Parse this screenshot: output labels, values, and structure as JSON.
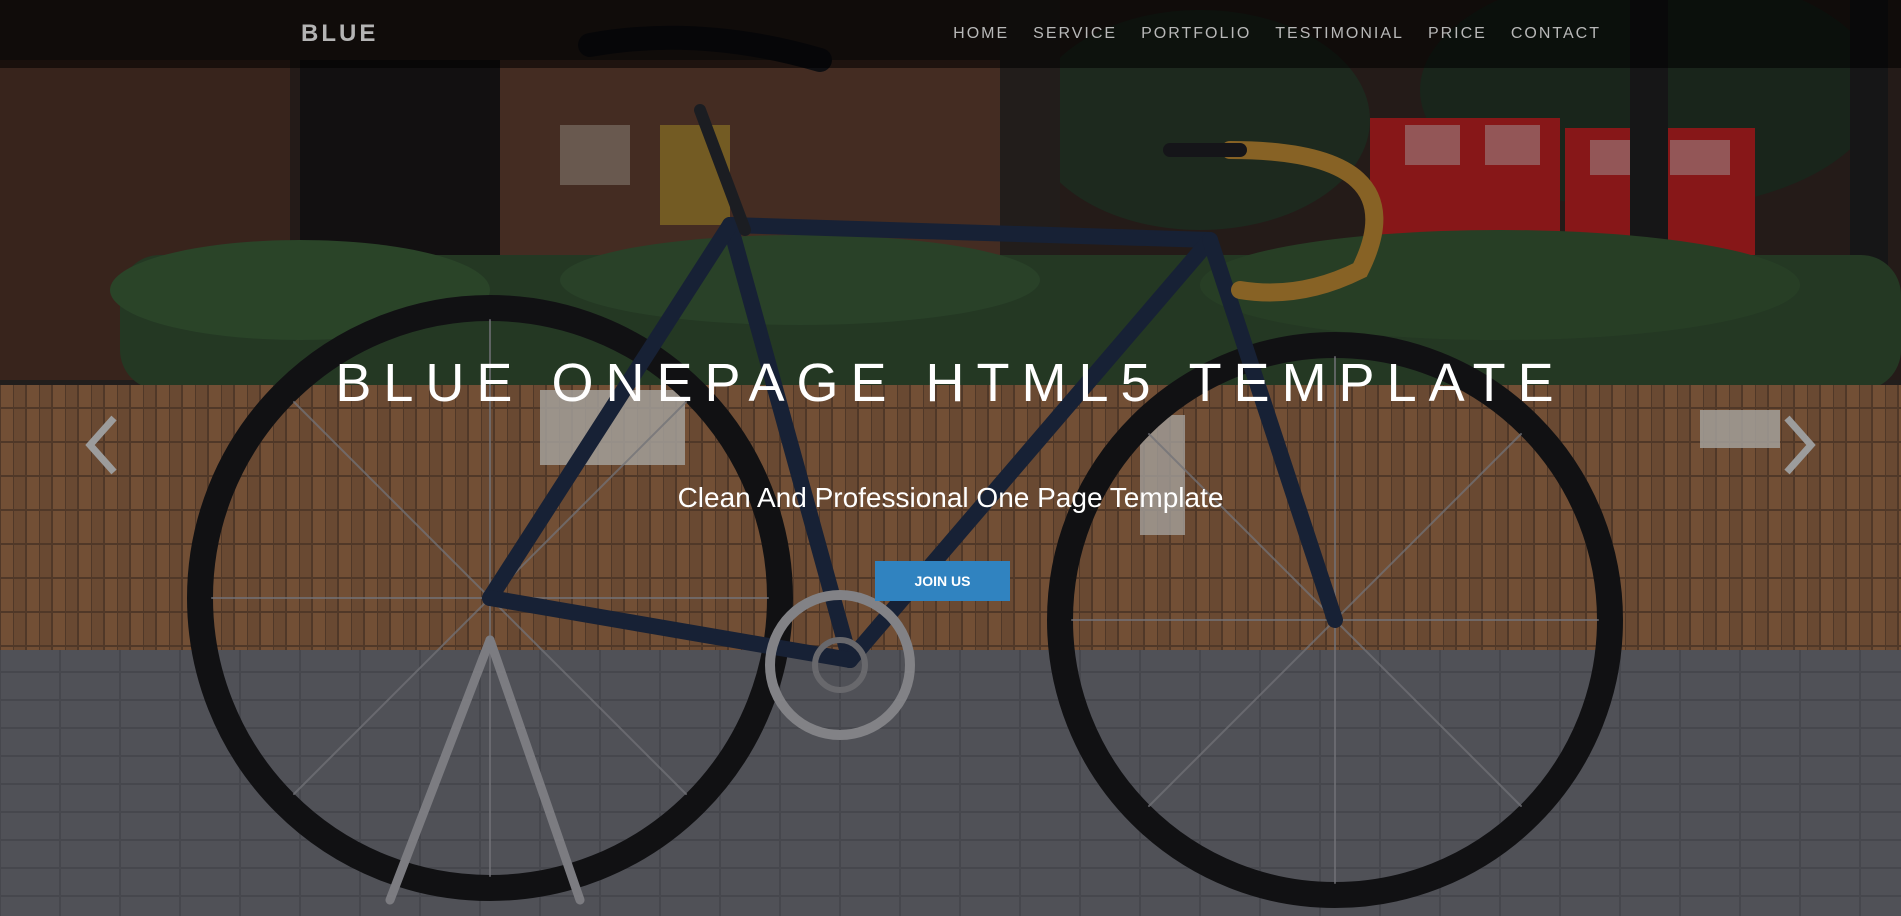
{
  "navbar": {
    "brand": "BLUE",
    "items": [
      {
        "label": "HOME"
      },
      {
        "label": "SERVICE"
      },
      {
        "label": "PORTFOLIO"
      },
      {
        "label": "TESTIMONIAL"
      },
      {
        "label": "PRICE"
      },
      {
        "label": "CONTACT"
      }
    ]
  },
  "hero": {
    "title": "BLUE ONEPAGE HTML5 TEMPLATE",
    "subtitle": "Clean And Professional One Page Template",
    "cta_label": "JOIN US",
    "prev_icon": "chevron-left-icon",
    "next_icon": "chevron-right-icon"
  },
  "colors": {
    "accent": "#3083c0",
    "nav_text": "#b8b8b8",
    "title_text": "#ffffff"
  }
}
